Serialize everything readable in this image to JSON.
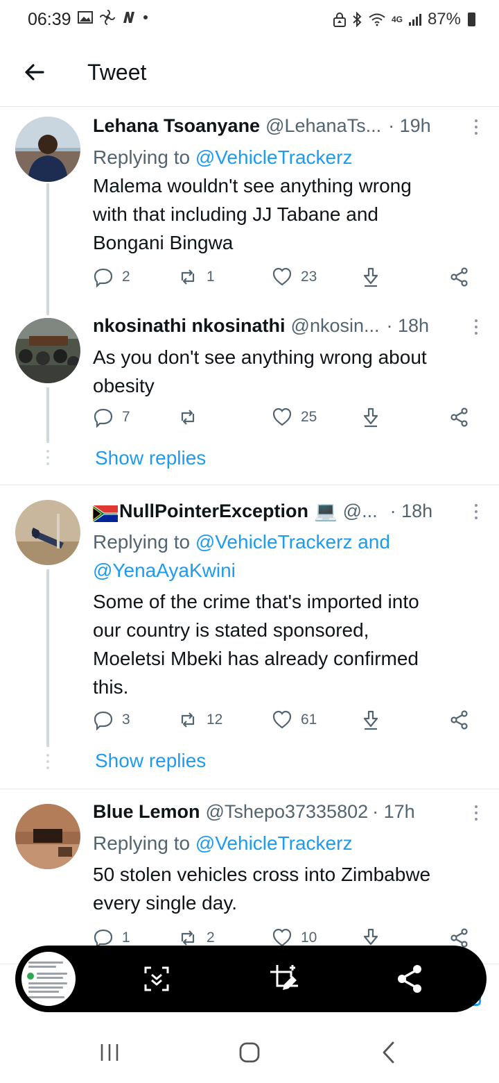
{
  "status_bar": {
    "time": "06:39",
    "network": "4G",
    "battery": "87%"
  },
  "header": {
    "title": "Tweet"
  },
  "tweets": [
    {
      "name": "Lehana Tsoanyane",
      "handle": "@LehanaTs...",
      "time": "· 19h",
      "replying_prefix": "Replying to ",
      "replying_to": "@VehicleTrackerz",
      "text_lines": [
        "Malema wouldn't see anything wrong",
        "with that including JJ Tabane and",
        "Bongani Bingwa"
      ],
      "replies": "2",
      "retweets": "1",
      "likes": "23"
    },
    {
      "name": "nkosinathi nkosinathi",
      "handle": "@nkosin...",
      "time": "· 18h",
      "text_lines": [
        "As you don't see anything wrong about",
        "obesity"
      ],
      "replies": "7",
      "retweets": "",
      "likes": "25",
      "show_replies": "Show replies"
    },
    {
      "name": "NullPointerException",
      "name_suffix": "💻",
      "handle": "@...",
      "time": "· 18h",
      "replying_prefix": "Replying to ",
      "replying_to": "@VehicleTrackerz and",
      "replying_to_2": "@YenaAyaKwini",
      "text_lines": [
        "Some of the crime that's imported into",
        "our country is stated sponsored,",
        "Moeletsi Mbeki has already confirmed",
        "this."
      ],
      "replies": "3",
      "retweets": "12",
      "likes": "61",
      "show_replies": "Show replies"
    },
    {
      "name": "Blue Lemon",
      "handle": "@Tshepo37335802",
      "time": "· 17h",
      "replying_prefix": "Replying to ",
      "replying_to": "@VehicleTrackerz",
      "text_lines": [
        "50 stolen vehicles cross into Zimbabwe",
        "every single day."
      ],
      "replies": "1",
      "retweets": "2",
      "likes": "10"
    }
  ],
  "colors": {
    "link": "#1d9bf0",
    "secondary_text": "#536471",
    "primary_text": "#0f1419",
    "toolbar_bg": "#000000"
  },
  "screenshot_toolbar": {
    "icons": [
      "scroll-capture-icon",
      "crop-edit-icon",
      "share-icon"
    ]
  },
  "nav_bar": {
    "icons": [
      "recents-icon",
      "home-icon",
      "back-icon"
    ]
  }
}
